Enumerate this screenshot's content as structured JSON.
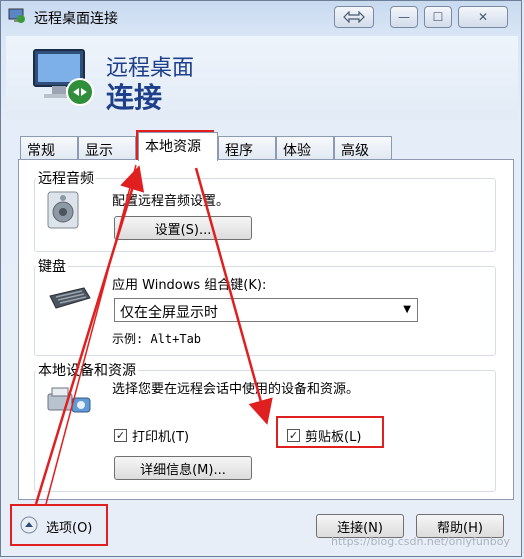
{
  "window": {
    "title": "远程桌面连接",
    "min": "—",
    "max": "☐",
    "close": "✕"
  },
  "hero": {
    "line1": "远程桌面",
    "line2": "连接"
  },
  "tabs": [
    "常规",
    "显示",
    "本地资源",
    "程序",
    "体验",
    "高级"
  ],
  "audio": {
    "title": "远程音频",
    "desc": "配置远程音频设置。",
    "button": "设置(S)..."
  },
  "keyboard": {
    "title": "键盘",
    "label": "应用 Windows 组合键(K):",
    "selected": "仅在全屏显示时",
    "example": "示例: Alt+Tab"
  },
  "devices": {
    "title": "本地设备和资源",
    "desc": "选择您要在远程会话中使用的设备和资源。",
    "printer": "打印机(T)",
    "clipboard": "剪贴板(L)",
    "details_button": "详细信息(M)..."
  },
  "footer": {
    "options": "选项(O)",
    "connect": "连接(N)",
    "help": "帮助(H)"
  },
  "watermark": "https://blog.csdn.net/onlyfunboy",
  "colors": {
    "annotation": "#e02020",
    "heading": "#1e3f8a"
  }
}
